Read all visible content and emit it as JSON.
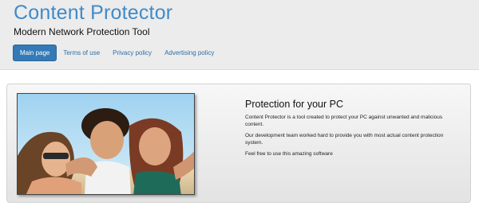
{
  "header": {
    "title": "Content Protector",
    "tagline": "Modern Network Protection Tool",
    "nav": [
      {
        "label": "Main page",
        "active": true
      },
      {
        "label": "Terms of use",
        "active": false
      },
      {
        "label": "Privacy policy",
        "active": false
      },
      {
        "label": "Advertising policy",
        "active": false
      }
    ]
  },
  "hero": {
    "heading": "Protection for your PC",
    "paragraphs": [
      "Content Protector is a tool created to protect your PC against unwanted and malicious content.",
      "Our development team worked hard to provide you with most actual content protection system.",
      "Feel free to use this amazing software"
    ]
  },
  "colors": {
    "brand": "#3f8bc9",
    "nav_active_bg": "#337ab7",
    "link": "#2e6da4"
  }
}
